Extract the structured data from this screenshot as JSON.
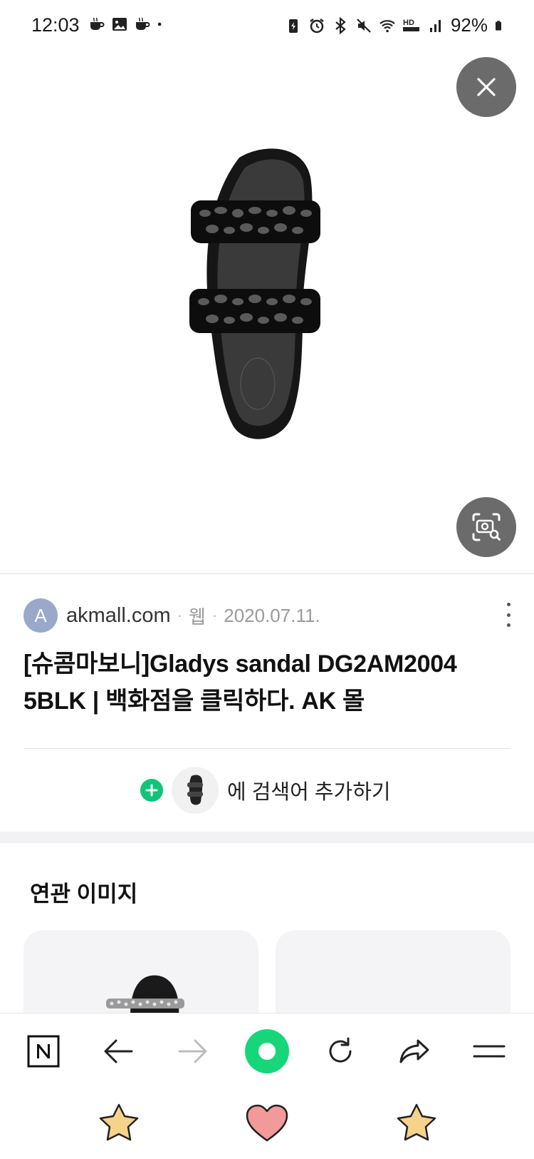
{
  "status_bar": {
    "time": "12:03",
    "left_icons": [
      "coffee-icon",
      "gallery-icon",
      "coffee-icon",
      "dot-icon"
    ],
    "right_icons": [
      "battery-saver-icon",
      "alarm-icon",
      "bluetooth-icon",
      "mute-icon",
      "wifi-icon",
      "hd-voice-icon",
      "signal-icon",
      "battery-icon"
    ],
    "hd_voice_label": "HD",
    "battery_percent": "92%"
  },
  "viewer": {
    "close_icon": "close-icon",
    "lens_icon": "image-search-icon",
    "image_subject": "black jeweled double-strap sandal"
  },
  "result": {
    "source_initial": "A",
    "source_domain": "akmall.com",
    "separator": "·",
    "source_type": "웹",
    "date": "2020.07.11.",
    "title_line1": "[슈콤마보니]Gladys sandal DG2AM2004",
    "title_line2": "5BLK | 백화점을 클릭하다. AK 몰",
    "add_keyword_text": "에 검색어 추가하기"
  },
  "related": {
    "title": "연관 이미지"
  },
  "toolbar": {
    "items": [
      "naver-n-icon",
      "back-arrow-icon",
      "forward-arrow-icon",
      "home-green-icon",
      "refresh-icon",
      "share-icon",
      "menu-icon"
    ],
    "accent_color": "#17d67a"
  },
  "dock": {
    "items": [
      "star-icon",
      "heart-icon",
      "star-icon"
    ],
    "star_color": "#f6d38a",
    "heart_color": "#f29a9a"
  }
}
